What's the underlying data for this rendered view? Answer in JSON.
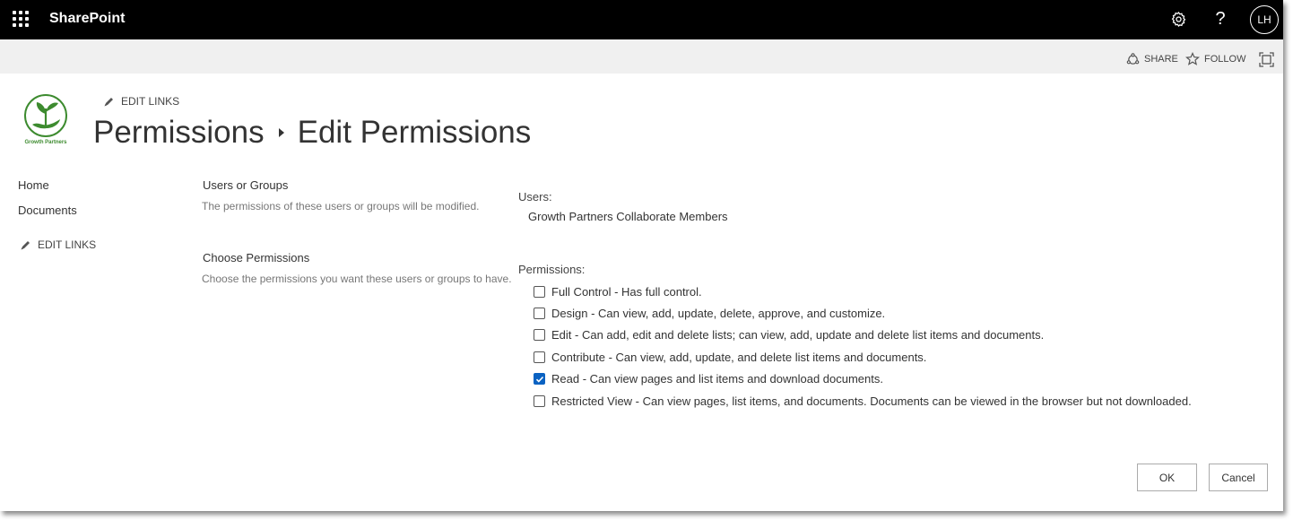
{
  "suitebar": {
    "brand": "SharePoint",
    "avatar_initials": "LH"
  },
  "actionbar": {
    "share_label": "SHARE",
    "follow_label": "FOLLOW"
  },
  "header": {
    "edit_links_label": "EDIT LINKS",
    "breadcrumb_parent": "Permissions",
    "breadcrumb_current": "Edit Permissions",
    "logo_text": "Growth Partners"
  },
  "leftnav": {
    "items": [
      {
        "label": "Home"
      },
      {
        "label": "Documents"
      }
    ],
    "edit_links_label": "EDIT LINKS"
  },
  "sections": {
    "users_or_groups": {
      "heading": "Users or Groups",
      "description": "The permissions of these users or groups will be modified."
    },
    "choose_permissions": {
      "heading": "Choose Permissions",
      "description": "Choose the permissions you want these users or groups to have."
    }
  },
  "users": {
    "label": "Users:",
    "value": "Growth Partners Collaborate Members"
  },
  "permissions": {
    "label": "Permissions:",
    "options": [
      {
        "label": "Full Control - Has full control.",
        "checked": false
      },
      {
        "label": "Design - Can view, add, update, delete, approve, and customize.",
        "checked": false
      },
      {
        "label": "Edit - Can add, edit and delete lists; can view, add, update and delete list items and documents.",
        "checked": false
      },
      {
        "label": "Contribute - Can view, add, update, and delete list items and documents.",
        "checked": false
      },
      {
        "label": "Read - Can view pages and list items and download documents.",
        "checked": true
      },
      {
        "label": "Restricted View - Can view pages, list items, and documents. Documents can be viewed in the browser but not downloaded.",
        "checked": false
      }
    ]
  },
  "buttons": {
    "ok_label": "OK",
    "cancel_label": "Cancel"
  },
  "colors": {
    "suitebar_bg": "#000000",
    "actionbar_bg": "#f0f0f0",
    "checkbox_checked": "#0a62c2",
    "logo_green": "#3d8b2f"
  },
  "icons": {
    "app_launcher": "waffle-icon",
    "settings": "gear-icon",
    "help": "help-icon",
    "share": "share-icon",
    "follow": "star-icon",
    "focus": "focus-mode-icon",
    "edit": "pencil-icon"
  }
}
